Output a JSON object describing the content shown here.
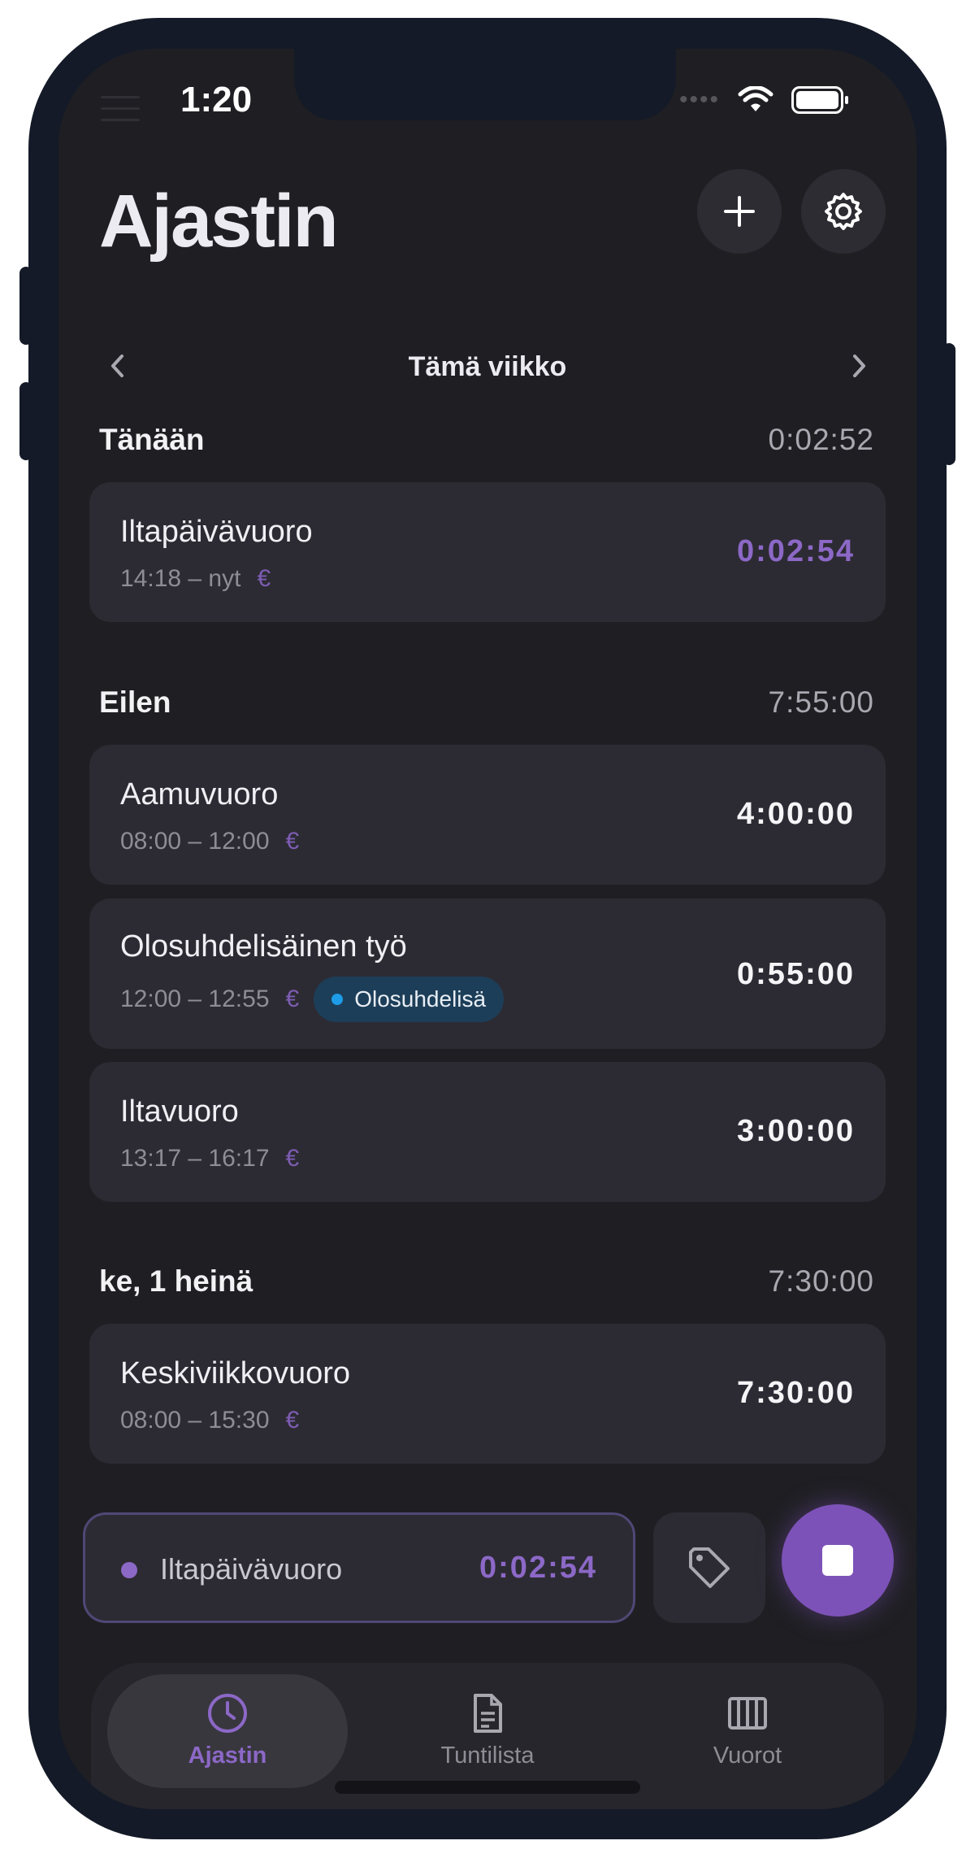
{
  "status_bar": {
    "time": "1:20",
    "signal_icon": "dots-icon",
    "wifi_icon": "wifi-icon",
    "battery_icon": "battery-icon"
  },
  "header": {
    "title": "Ajastin",
    "add_icon": "plus-icon",
    "settings_icon": "gear-icon"
  },
  "week_nav": {
    "label": "Tämä viikko",
    "prev_icon": "chevron-left-icon",
    "next_icon": "chevron-right-icon"
  },
  "sections": [
    {
      "day": "Tänään",
      "total": "0:02:52",
      "entries": [
        {
          "name": "Iltapäivävuoro",
          "time_range": "14:18 – nyt",
          "euro": "€",
          "duration": "0:02:54",
          "active": true
        }
      ]
    },
    {
      "day": "Eilen",
      "total": "7:55:00",
      "entries": [
        {
          "name": "Aamuvuoro",
          "time_range": "08:00 – 12:00",
          "euro": "€",
          "duration": "4:00:00"
        },
        {
          "name": "Olosuhdelisäinen työ",
          "time_range": "12:00 – 12:55",
          "euro": "€",
          "tag": "Olosuhdelisä",
          "duration": "0:55:00"
        },
        {
          "name": "Iltavuoro",
          "time_range": "13:17 – 16:17",
          "euro": "€",
          "duration": "3:00:00"
        }
      ]
    },
    {
      "day": "ke, 1 heinä",
      "total": "7:30:00",
      "entries": [
        {
          "name": "Keskiviikkovuoro",
          "time_range": "08:00 – 15:30",
          "euro": "€",
          "duration": "7:30:00"
        }
      ]
    }
  ],
  "running_timer": {
    "name": "Iltapäivävuoro",
    "elapsed": "0:02:54",
    "tag_icon": "tag-icon",
    "stop_icon": "stop-icon"
  },
  "tabs": [
    {
      "label": "Ajastin",
      "icon": "clock-icon",
      "active": true
    },
    {
      "label": "Tuntilista",
      "icon": "document-icon",
      "active": false
    },
    {
      "label": "Vuorot",
      "icon": "columns-icon",
      "active": false
    }
  ],
  "colors": {
    "background": "#1f1f23",
    "card": "#2c2b33",
    "accent": "#8c68c7",
    "tag_bg": "#1d3e58",
    "tag_dot": "#1d9de8"
  }
}
